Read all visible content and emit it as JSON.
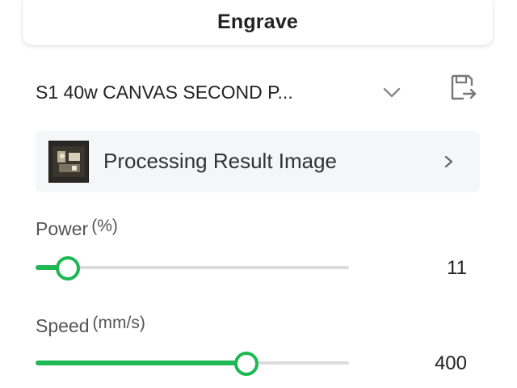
{
  "mode": {
    "label": "Engrave"
  },
  "material": {
    "name": "S1 40w CANVAS SECOND P...",
    "dropdown_icon": "chevron-down-icon",
    "export_icon": "export-icon"
  },
  "processing": {
    "label": "Processing Result Image",
    "thumbnail_icon": "image-thumbnail",
    "arrow_icon": "chevron-right-icon"
  },
  "power": {
    "label": "Power",
    "unit": "(%)",
    "value": "11",
    "fraction": 0.1
  },
  "speed": {
    "label": "Speed",
    "unit": "(mm/s)",
    "value": "400",
    "fraction": 0.67
  },
  "colors": {
    "accent": "#1db853",
    "track": "#dcdcdc",
    "row_bg": "#f5f6f8"
  }
}
